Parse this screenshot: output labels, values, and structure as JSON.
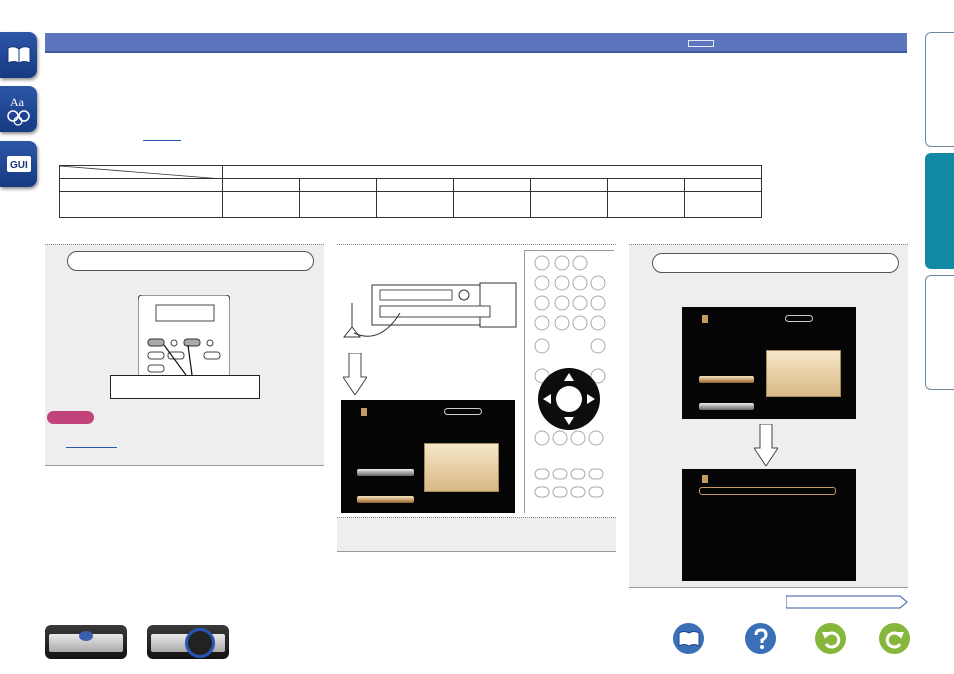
{
  "page": {
    "header_badge_text": "",
    "table": {
      "columns": 7,
      "rows": 3
    }
  },
  "icons": {
    "left_tabs": [
      "book-icon",
      "font-glossary-icon",
      "gui-icon"
    ],
    "bottom_left": [
      "amplifier-front-icon",
      "amplifier-knob-icon"
    ],
    "bottom_right": [
      "manual-book-icon",
      "help-question-icon",
      "back-arrow-icon",
      "forward-arrow-icon"
    ]
  },
  "colors": {
    "header": "#5b76bd",
    "tab_active": "#138aa3",
    "tab_dark": "#1b3f8a",
    "note_badge": "#c2427a",
    "panel_bg": "#eeeeee"
  }
}
